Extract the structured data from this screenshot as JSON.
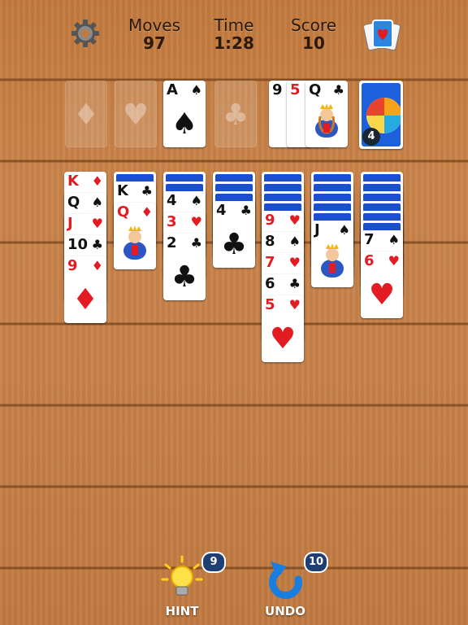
{
  "hud": {
    "moves_label": "Moves",
    "moves_value": "97",
    "time_label": "Time",
    "time_value": "1:28",
    "score_label": "Score",
    "score_value": "10"
  },
  "foundations": [
    {
      "suit_icon": "diamond-icon",
      "glyph": "♦",
      "card": null
    },
    {
      "suit_icon": "heart-icon",
      "glyph": "♥",
      "card": null
    },
    {
      "suit_icon": "spade-icon",
      "glyph": "♠",
      "card": {
        "rank": "A",
        "suit": "♠"
      }
    },
    {
      "suit_icon": "club-icon",
      "glyph": "♣",
      "card": null
    }
  ],
  "waste": [
    {
      "rank": "9",
      "suit": "♠"
    },
    {
      "rank": "5",
      "suit": "♦"
    },
    {
      "rank": "Q",
      "suit": "♣"
    }
  ],
  "stock": {
    "count": "4"
  },
  "tableau": [
    {
      "name": "col1",
      "hidden": 0,
      "cards": [
        {
          "rank": "K",
          "suit": "♦"
        },
        {
          "rank": "Q",
          "suit": "♠"
        },
        {
          "rank": "J",
          "suit": "♥"
        },
        {
          "rank": "10",
          "suit": "♣"
        },
        {
          "rank": "9",
          "suit": "♦"
        }
      ]
    },
    {
      "name": "col2",
      "hidden": 1,
      "cards": [
        {
          "rank": "K",
          "suit": "♣"
        },
        {
          "rank": "Q",
          "suit": "♦"
        }
      ]
    },
    {
      "name": "col3",
      "hidden": 2,
      "cards": [
        {
          "rank": "4",
          "suit": "♠"
        },
        {
          "rank": "3",
          "suit": "♥"
        },
        {
          "rank": "2",
          "suit": "♣"
        }
      ]
    },
    {
      "name": "col4",
      "hidden": 3,
      "cards": [
        {
          "rank": "4",
          "suit": "♣"
        }
      ]
    },
    {
      "name": "col5",
      "hidden": 4,
      "cards": [
        {
          "rank": "9",
          "suit": "♥"
        },
        {
          "rank": "8",
          "suit": "♠"
        },
        {
          "rank": "7",
          "suit": "♥"
        },
        {
          "rank": "6",
          "suit": "♣"
        },
        {
          "rank": "5",
          "suit": "♥"
        }
      ]
    },
    {
      "name": "col6",
      "hidden": 5,
      "cards": [
        {
          "rank": "J",
          "suit": "♠"
        }
      ]
    },
    {
      "name": "col7",
      "hidden": 6,
      "cards": [
        {
          "rank": "7",
          "suit": "♠"
        },
        {
          "rank": "6",
          "suit": "♥"
        }
      ]
    }
  ],
  "controls": {
    "hint_label": "HINT",
    "hint_count": "9",
    "undo_label": "UNDO",
    "undo_count": "10"
  },
  "colors": {
    "red": "#e31b23",
    "black": "#111111",
    "card_back": "#1b4fd1"
  },
  "icons": [
    "settings-gear-icon",
    "deck-theme-icon",
    "lightbulb-icon",
    "undo-arrow-icon"
  ]
}
